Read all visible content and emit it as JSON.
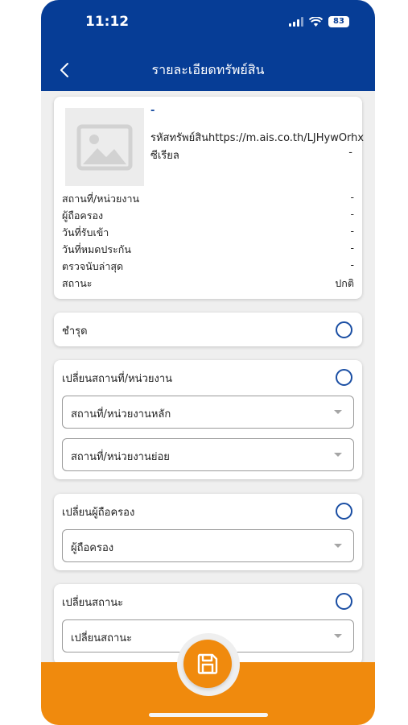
{
  "status_bar": {
    "time": "11:12",
    "battery": "83"
  },
  "header": {
    "title": "รายละเอียดทรัพย์สิน"
  },
  "asset": {
    "name": "-",
    "code": "รหัสทรัพย์สินhttps://m.ais.co.th/LJHywOrhx",
    "serial_label": "ซีเรียล",
    "serial_value": "-",
    "details": [
      {
        "label": "สถานที่/หน่วยงาน",
        "value": "-"
      },
      {
        "label": "ผู้ถือครอง",
        "value": "-"
      },
      {
        "label": "วันที่รับเข้า",
        "value": "-"
      },
      {
        "label": "วันที่หมดประกัน",
        "value": "-"
      },
      {
        "label": "ตรวจนับล่าสุด",
        "value": "-"
      },
      {
        "label": "สถานะ",
        "value": "ปกติ"
      }
    ]
  },
  "sections": {
    "damaged": {
      "title": "ชำรุด"
    },
    "change_location": {
      "title": "เปลี่ยนสถานที่/หน่วยงาน",
      "main_select": "สถานที่/หน่วยงานหลัก",
      "sub_select": "สถานที่/หน่วยงานย่อย"
    },
    "change_holder": {
      "title": "เปลี่ยนผู้ถือครอง",
      "holder_select": "ผู้ถือครอง"
    },
    "change_status": {
      "title": "เปลี่ยนสถานะ",
      "status_select": "เปลี่ยนสถานะ"
    }
  },
  "icons": {
    "back": "chevron-left-icon",
    "image_placeholder": "image-placeholder-icon",
    "save": "save-icon"
  },
  "colors": {
    "header": "#063d96",
    "accent": "#1a4ea3",
    "bottom_bar": "#f08a0d"
  }
}
